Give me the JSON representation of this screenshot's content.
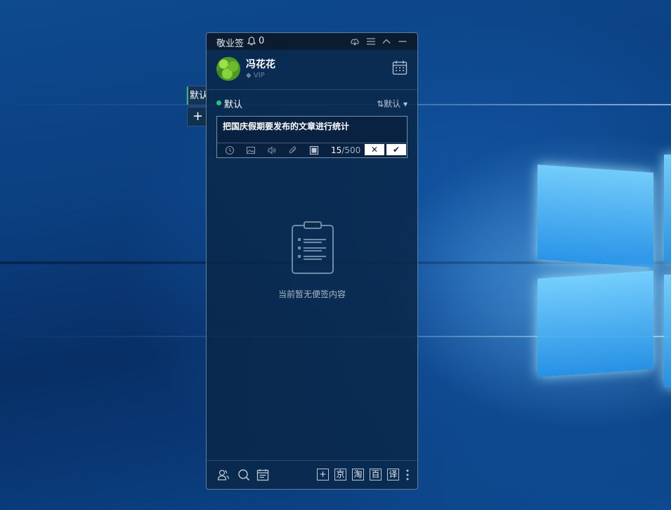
{
  "app": {
    "title": "敬业签",
    "notification_count": "0"
  },
  "side_tabs": {
    "active_label": "默认",
    "add_label": "+"
  },
  "profile": {
    "username": "冯花花",
    "badge": "VIP"
  },
  "group": {
    "name": "默认",
    "sort_label": "默认",
    "status_color": "#2bc47a"
  },
  "editor": {
    "text": "把国庆假期要发布的文章进行统计",
    "char_count": "15",
    "char_limit": "/500",
    "cancel_label": "✕",
    "confirm_label": "✔"
  },
  "empty_state": {
    "message": "当前暂无便签内容"
  },
  "bottom_bar": {
    "buttons": [
      "+",
      "京",
      "淘",
      "百",
      "译"
    ]
  },
  "icons": [
    "bell-icon",
    "cloud-sync-icon",
    "menu-icon",
    "collapse-icon",
    "minimize-icon",
    "calendar-icon",
    "clock-icon",
    "image-icon",
    "audio-icon",
    "attachment-icon",
    "stop-icon",
    "contacts-icon",
    "search-icon",
    "calendar-list-icon",
    "more-icon",
    "clipboard-icon"
  ]
}
